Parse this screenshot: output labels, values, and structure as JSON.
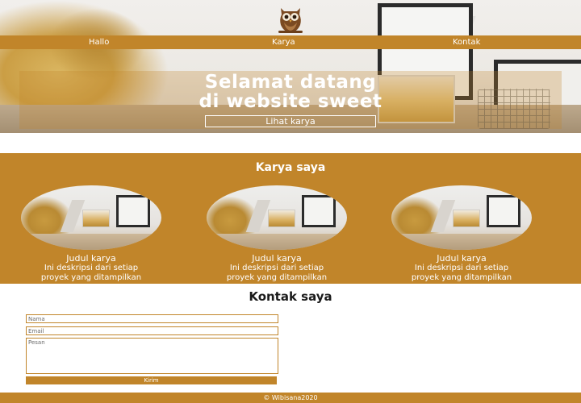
{
  "nav": {
    "items": [
      {
        "label": "Hallo"
      },
      {
        "label": "Karya"
      },
      {
        "label": "Kontak"
      }
    ]
  },
  "hero": {
    "title_line1": "Selamat datang",
    "title_line2": "di website sweet",
    "cta_label": "Lihat karya"
  },
  "works": {
    "title": "Karya saya",
    "cards": [
      {
        "name": "Judul karya",
        "desc_line1": "Ini deskripsi dari setiap",
        "desc_line2": "proyek yang ditampilkan"
      },
      {
        "name": "Judul karya",
        "desc_line1": "Ini deskripsi dari setiap",
        "desc_line2": "proyek yang ditampilkan"
      },
      {
        "name": "Judul karya",
        "desc_line1": "Ini deskripsi dari setiap",
        "desc_line2": "proyek yang ditampilkan"
      }
    ]
  },
  "contact": {
    "title": "Kontak saya",
    "name_placeholder": "Nama",
    "email_placeholder": "Email",
    "message_placeholder": "Pesan",
    "send_label": "Kirim"
  },
  "footer": {
    "text": "© Wibisana2020"
  },
  "colors": {
    "accent": "#c1852a",
    "text_light": "#ffffff",
    "text_dark": "#1a1a1a"
  },
  "icons": {
    "logo": "owl-icon"
  }
}
